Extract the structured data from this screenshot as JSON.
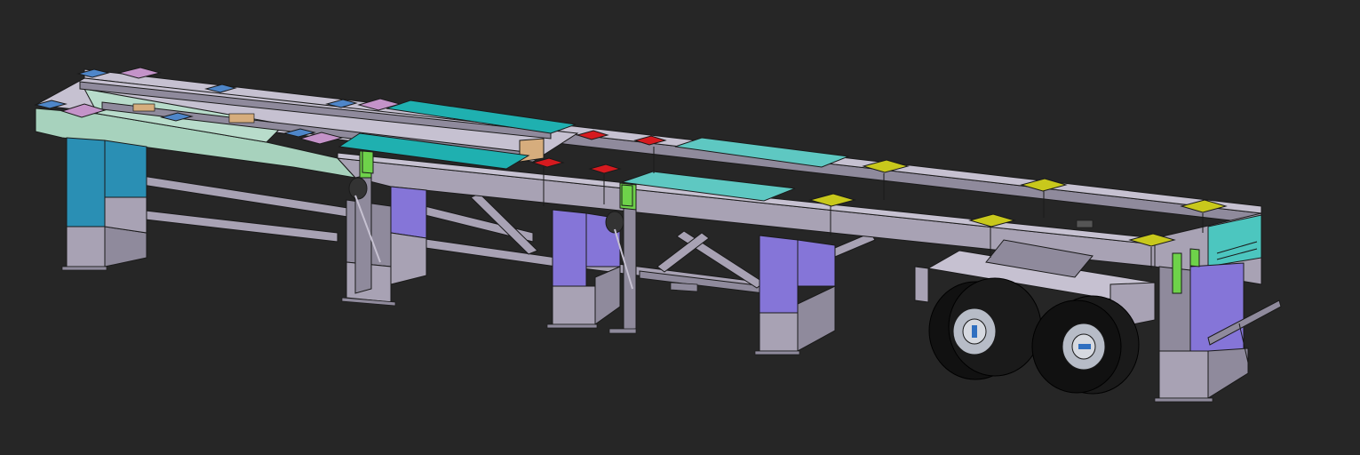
{
  "viewport": {
    "background": "#262626"
  },
  "model": {
    "frame_color": "#a8a2b4",
    "frame_shadow": "#8f8a9c",
    "frame_light": "#c6c1d1",
    "leg_purple": "#8575d8",
    "leg_teal": "#2a8fb4",
    "gooseneck_mint": "#a7d2bd",
    "deck_teal": "#1fb0b0",
    "deck_teal_light": "#5ec8c2",
    "twistlock_blue": "#4e86c9",
    "twistlock_pink": "#c493c9",
    "twistlock_red": "#d61a1f",
    "twistlock_yellow": "#c8c81c",
    "bracket_green": "#6ed24a",
    "timber": "#d6ad7d",
    "tire": "#111111",
    "hub": "#b7bcc7",
    "hub_accent": "#2f6fc0",
    "axle_count": 2
  }
}
